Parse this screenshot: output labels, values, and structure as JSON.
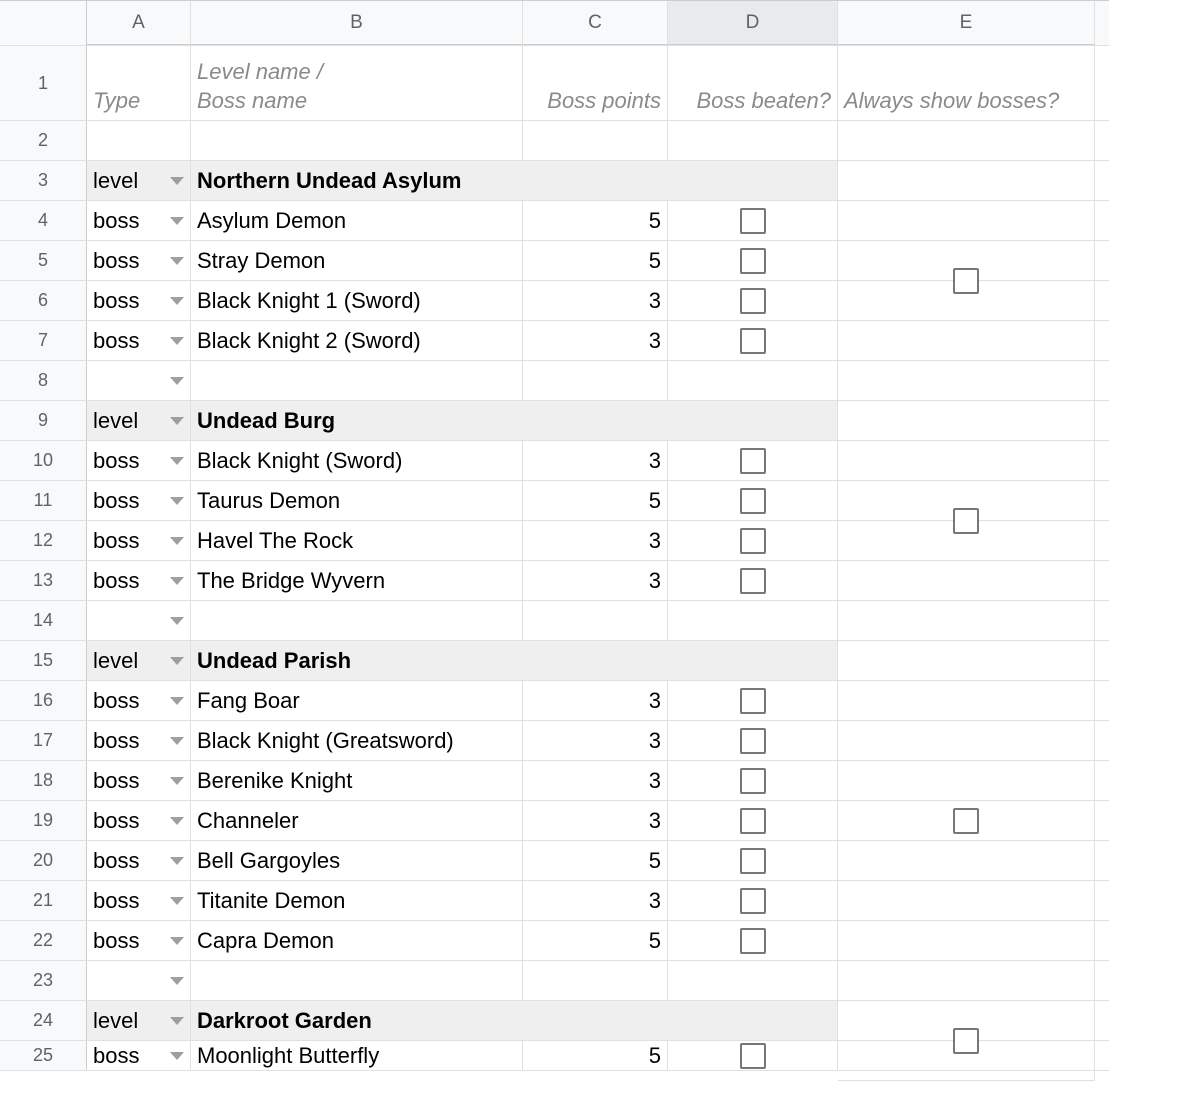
{
  "columns": [
    "A",
    "B",
    "C",
    "D",
    "E"
  ],
  "selected_column": "D",
  "header": {
    "A": "Type",
    "B": "Level name /\nBoss name",
    "C": "Boss points",
    "D": "Boss beaten?",
    "E": "Always show bosses?"
  },
  "type_labels": {
    "level": "level",
    "boss": "boss"
  },
  "rows": [
    {
      "n": 1,
      "kind": "header"
    },
    {
      "n": 2,
      "kind": "blank"
    },
    {
      "n": 3,
      "kind": "level",
      "name": "Northern Undead Asylum",
      "first_of_group": true,
      "group_span": 6
    },
    {
      "n": 4,
      "kind": "boss",
      "name": "Asylum Demon",
      "points": 5
    },
    {
      "n": 5,
      "kind": "boss",
      "name": "Stray Demon",
      "points": 5
    },
    {
      "n": 6,
      "kind": "boss",
      "name": "Black Knight 1 (Sword)",
      "points": 3
    },
    {
      "n": 7,
      "kind": "boss",
      "name": "Black Knight 2 (Sword)",
      "points": 3
    },
    {
      "n": 8,
      "kind": "dropdown_blank"
    },
    {
      "n": 9,
      "kind": "level",
      "name": "Undead Burg",
      "first_of_group": true,
      "group_span": 6
    },
    {
      "n": 10,
      "kind": "boss",
      "name": "Black Knight (Sword)",
      "points": 3
    },
    {
      "n": 11,
      "kind": "boss",
      "name": "Taurus Demon",
      "points": 5
    },
    {
      "n": 12,
      "kind": "boss",
      "name": "Havel The Rock",
      "points": 3
    },
    {
      "n": 13,
      "kind": "boss",
      "name": "The Bridge Wyvern",
      "points": 3
    },
    {
      "n": 14,
      "kind": "dropdown_blank"
    },
    {
      "n": 15,
      "kind": "level",
      "name": "Undead Parish",
      "first_of_group": true,
      "group_span": 9
    },
    {
      "n": 16,
      "kind": "boss",
      "name": "Fang Boar",
      "points": 3
    },
    {
      "n": 17,
      "kind": "boss",
      "name": "Black Knight (Greatsword)",
      "points": 3
    },
    {
      "n": 18,
      "kind": "boss",
      "name": "Berenike Knight",
      "points": 3
    },
    {
      "n": 19,
      "kind": "boss",
      "name": "Channeler",
      "points": 3
    },
    {
      "n": 20,
      "kind": "boss",
      "name": "Bell Gargoyles",
      "points": 5
    },
    {
      "n": 21,
      "kind": "boss",
      "name": "Titanite Demon",
      "points": 3
    },
    {
      "n": 22,
      "kind": "boss",
      "name": "Capra Demon",
      "points": 5
    },
    {
      "n": 23,
      "kind": "dropdown_blank"
    },
    {
      "n": 24,
      "kind": "level",
      "name": "Darkroot Garden",
      "first_of_group": true,
      "group_span": 2
    },
    {
      "n": 25,
      "kind": "boss",
      "name": "Moonlight Butterfly",
      "points": 5,
      "partial": true
    }
  ]
}
